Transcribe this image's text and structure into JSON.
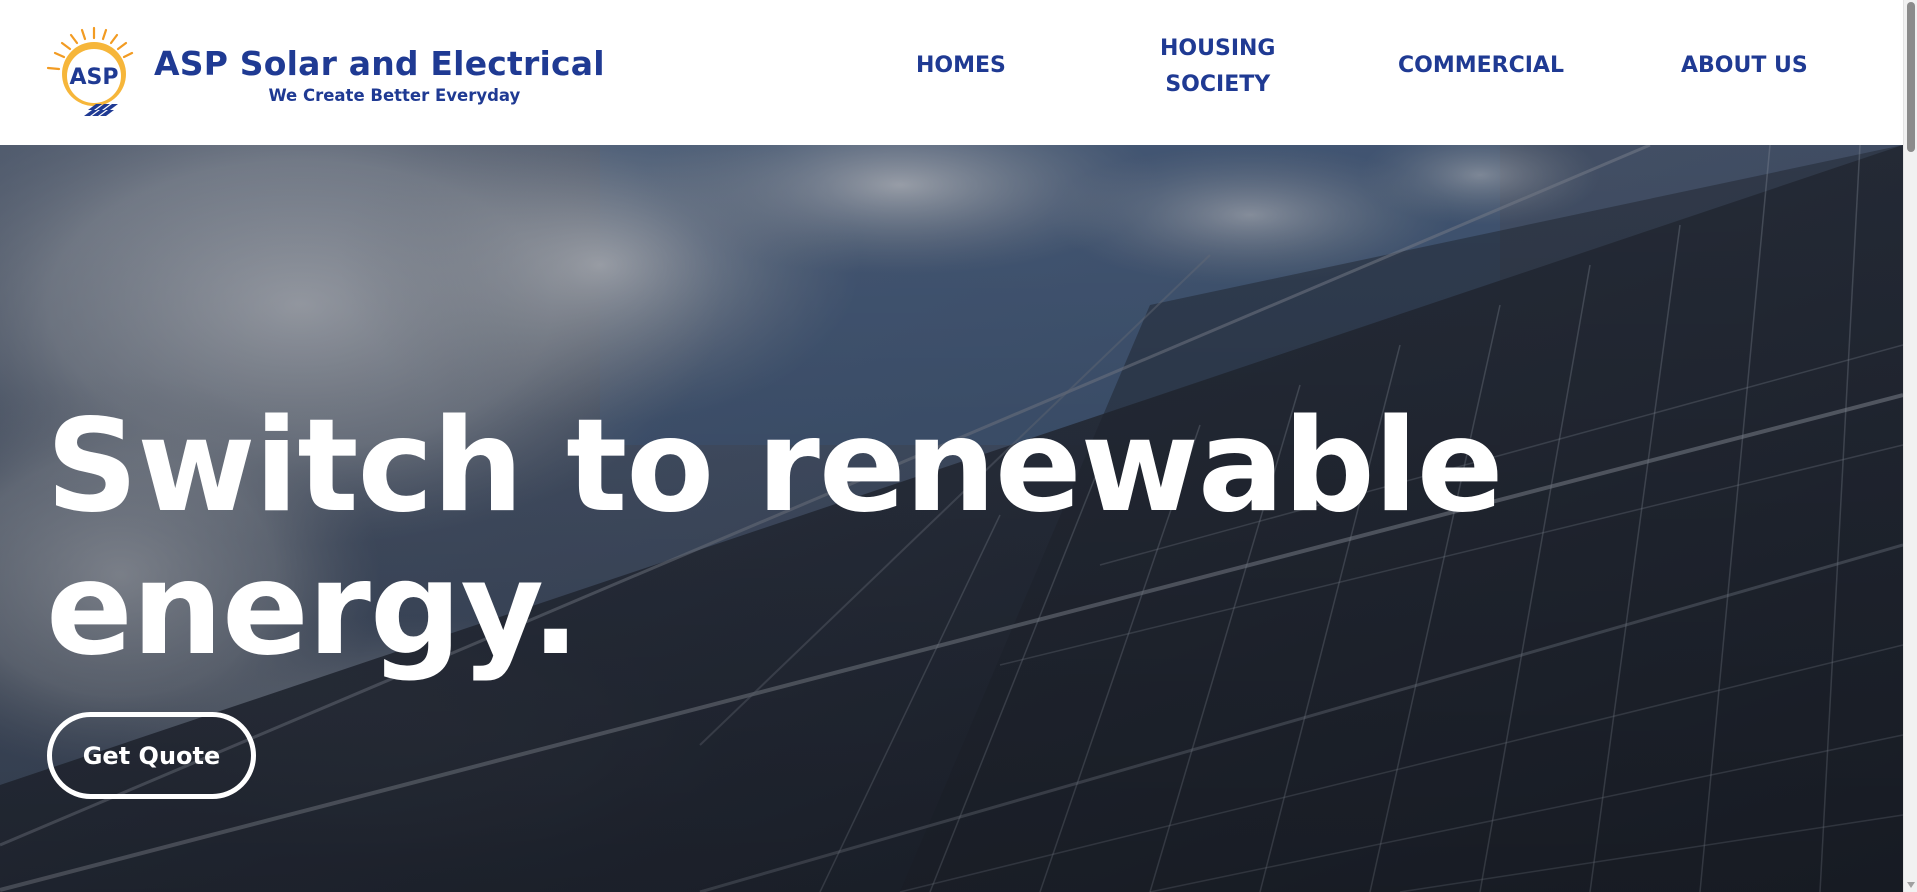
{
  "brand": {
    "logo_text": "ASP",
    "name": "ASP Solar and Electrical",
    "tagline": "We Create Better Everyday"
  },
  "nav": {
    "homes": "HOMES",
    "housing_line1": "HOUSING",
    "housing_line2": "SOCIETY",
    "commercial": "COMMERCIAL",
    "about": "ABOUT US"
  },
  "hero": {
    "title_line1": "Switch to renewable",
    "title_line2": "energy.",
    "cta_label": "Get Quote",
    "background_description_icon": "solar-panel-sky-image"
  },
  "colors": {
    "brand_blue": "#1f3a93",
    "sun_orange": "#f29b22",
    "hero_text": "#ffffff",
    "header_bg": "#ffffff"
  }
}
